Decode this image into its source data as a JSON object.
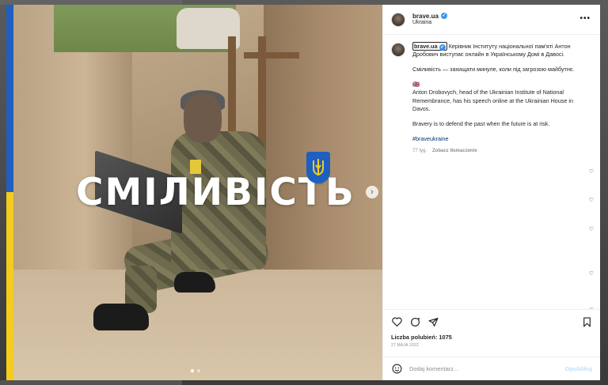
{
  "post": {
    "username": "brave.ua",
    "location": "Ukraina",
    "image_headline": "СМІЛИВІСТЬ",
    "caption": {
      "ukrainian": "Керівник Інституту національної пам'яті Антон Дробович виступає онлайн в Українському Домі в Давосі.",
      "ukrainian_quote": "Сміливість — захищати минуле, коли під загрозою майбутнє.",
      "flag_marker": "🇬🇧",
      "english": "Anton Drobovych, head of the Ukrainian Institute of National Remembrance, has his speech online at the Ukrainian House in Davos.",
      "english_quote": "Bravery is to defend the past when the future is at risk.",
      "hashtag": "#braveukraine"
    },
    "age": "77 tyg.",
    "translate_label": "Zobacz tłumaczenie",
    "likes": "Liczba polubień: 1075",
    "date": "27 MAJA 2022",
    "comment_placeholder": "Dodaj komentarz...",
    "post_button": "Opublikuj"
  },
  "icons": {
    "more": "more-options-icon",
    "like": "heart-icon",
    "comment": "comment-icon",
    "share": "share-icon",
    "save": "bookmark-icon",
    "emoji": "emoji-icon",
    "verified": "verified-badge-icon",
    "next": "chevron-right-icon"
  },
  "colors": {
    "flag_blue": "#1f5fbf",
    "flag_yellow": "#f4cc1c",
    "verified": "#3897f0",
    "hashtag": "#00376b"
  }
}
